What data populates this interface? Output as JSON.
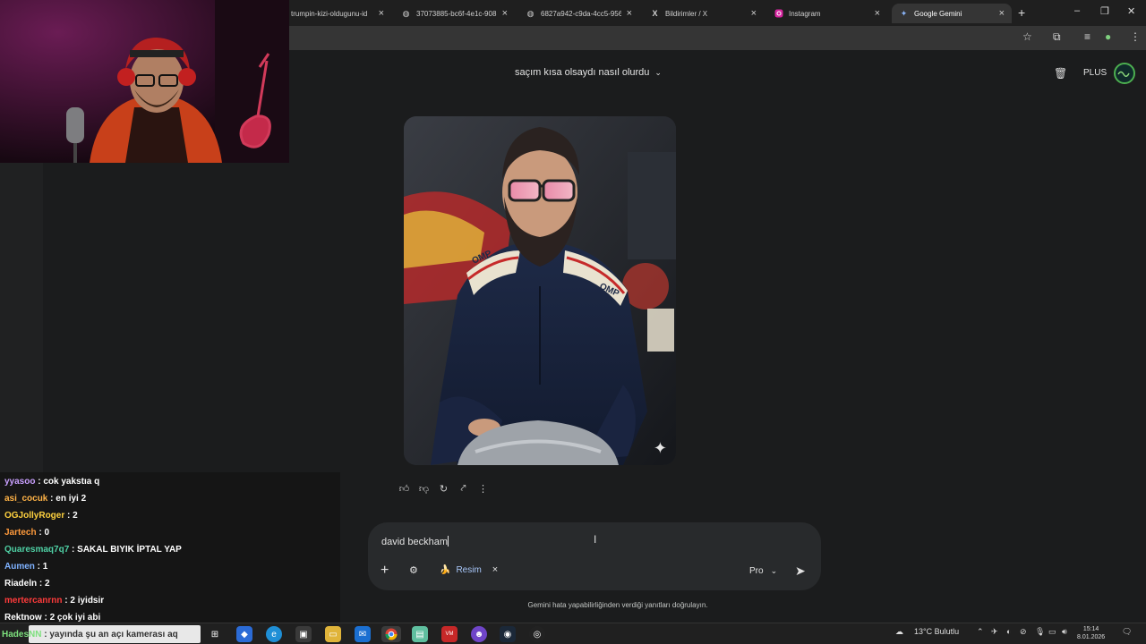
{
  "browser": {
    "tabs": [
      {
        "title": "trumpin-kizi-oldugunu-id",
        "icon": "page-icon",
        "active": false
      },
      {
        "title": "37073885-bc6f-4e1c-908",
        "icon": "globe-icon",
        "active": false
      },
      {
        "title": "6827a942-c9da-4cc5-956",
        "icon": "globe-icon",
        "active": false
      },
      {
        "title": "Bildirimler / X",
        "icon": "x-logo-icon",
        "active": false
      },
      {
        "title": "Instagram",
        "icon": "instagram-icon",
        "active": false
      },
      {
        "title": "Google Gemini",
        "icon": "gemini-icon",
        "active": true
      }
    ],
    "tab_close_glyph": "×",
    "new_tab_glyph": "+",
    "window_controls": [
      "–",
      "❐",
      "✕"
    ]
  },
  "gemini": {
    "conversation_title": "saçım kısa olsaydı nasıl olurdu",
    "plan_label": "PLUS",
    "prompt_text": "david beckham",
    "chip_label": "Resim",
    "chip_emoji": "🍌",
    "model_label": "Pro",
    "disclaimer": "Gemini hata yapabilirliğinden verdiği yanıtları doğrulayın.",
    "photo_alt": "Generated image of a bearded man in a navy racing suit with OMP patches and pink sunglasses"
  },
  "chat": {
    "messages": [
      {
        "user": "yyasoo",
        "text": "cok yakstıa q",
        "color": "#c9a0ff"
      },
      {
        "user": "asi_cocuk",
        "text": "en iyi 2",
        "color": "#ffb347"
      },
      {
        "user": "OGJollyRoger",
        "text": "2",
        "color": "#ffd23f"
      },
      {
        "user": "Jartech",
        "text": "0",
        "color": "#ff9a3c"
      },
      {
        "user": "Quaresmaq7q7",
        "text": "SAKAL BIYIK İPTAL YAP",
        "color": "#4fd1a5"
      },
      {
        "user": "Aumen",
        "text": "1",
        "color": "#7fb2ff"
      },
      {
        "user": "Riadeln",
        "text": "2",
        "color": "#ffffff"
      },
      {
        "user": "mertercanrnn",
        "text": "2 iyidsir",
        "color": "#ff3b3b"
      },
      {
        "user": "Rektnow",
        "text": "2 çok iyi abi",
        "color": "#ffffff"
      }
    ],
    "alert": {
      "user": "HadesNN",
      "text": "yayında şu an açı kamerası aq",
      "color": "#7de07d"
    }
  },
  "taskbar": {
    "weather": "13°C  Bulutlu",
    "time": "15:14",
    "date": "8.01.2026"
  },
  "colors": {
    "background": "#1b1c1d",
    "prompt_box": "#282a2c",
    "chip_accent": "#a8c7fa",
    "avatar_ring": "#4caf50"
  }
}
